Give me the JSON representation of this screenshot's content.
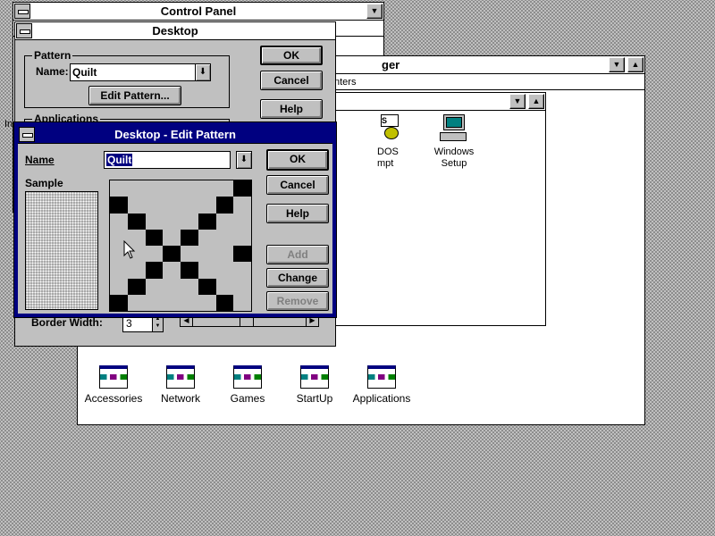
{
  "control_panel": {
    "title": "Control Panel",
    "partial_labels": [
      "S",
      "In"
    ]
  },
  "program_manager": {
    "title_fragment": "ger",
    "printers_fragment": "nters",
    "group_icons": [
      {
        "label": "Accessories",
        "icon": "program-group-icon"
      },
      {
        "label": "Network",
        "icon": "program-group-icon"
      },
      {
        "label": "Games",
        "icon": "program-group-icon"
      },
      {
        "label": "StartUp",
        "icon": "program-group-icon"
      },
      {
        "label": "Applications",
        "icon": "program-group-icon"
      }
    ],
    "main_group": {
      "items": [
        {
          "label": "DOS\nmpt",
          "icon": "ms-dos-prompt-icon"
        },
        {
          "label": "Windows\nSetup",
          "icon": "windows-setup-icon"
        }
      ]
    }
  },
  "desktop_dialog": {
    "title": "Desktop",
    "pattern_group": "Pattern",
    "name_label": "Name:",
    "name_value": "Quilt",
    "edit_pattern_button": "Edit Pattern...",
    "applications_group": "Applications",
    "border_width_label": "Border Width:",
    "border_width_value": "3",
    "ok_button": "OK",
    "cancel_button": "Cancel",
    "help_button": "Help"
  },
  "edit_pattern_dialog": {
    "title": "Desktop - Edit Pattern",
    "name_label": "Name",
    "name_value": "Quilt",
    "sample_label": "Sample",
    "ok_button": "OK",
    "cancel_button": "Cancel",
    "help_button": "Help",
    "add_button": "Add",
    "change_button": "Change",
    "remove_button": "Remove",
    "pattern_rows": [
      "00000001",
      "10000010",
      "01000100",
      "00101000",
      "00010001",
      "00101000",
      "01000100",
      "10000010"
    ]
  },
  "colors": {
    "active_title": "#000080",
    "dialog_face": "#c0c0c0",
    "desktop_dots": "#808080"
  }
}
